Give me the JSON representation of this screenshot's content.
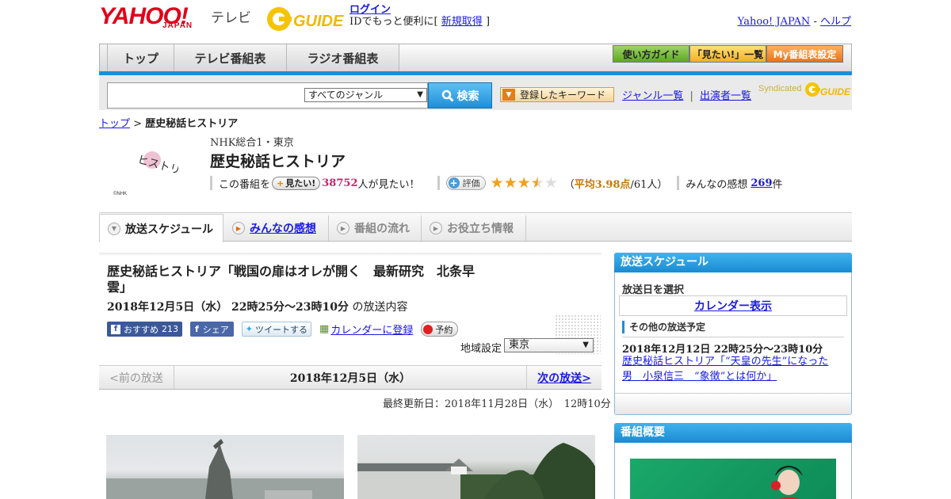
{
  "header": {
    "logo_yahoo": "YAHOO!",
    "logo_japan": "JAPAN",
    "logo_tv": "テレビ",
    "login": "ログイン",
    "login_note_pre": "IDでもっと便利に[",
    "register": "新規取得",
    "login_note_post": "]",
    "yahoo_japan": "Yahoo! JAPAN",
    "dash": "-",
    "help": "ヘルプ"
  },
  "nav": {
    "tabs": [
      "トップ",
      "テレビ番組表",
      "ラジオ番組表"
    ],
    "guide": "使い方ガイド",
    "mitai_list": "「見たい!」一覧",
    "my_settings": "My番組表設定"
  },
  "search": {
    "genre": "すべてのジャンル",
    "button": "検索",
    "keyword_btn": "登録したキーワード",
    "genre_list": "ジャンル一覧",
    "divider": "|",
    "performers": "出演者一覧",
    "syndicated": "Syndicated"
  },
  "breadcrumb": {
    "top": "トップ",
    "sep": ">",
    "current": "歴史秘話ヒストリア"
  },
  "program": {
    "channel": "NHK総合1・東京",
    "title": "歴史秘話ヒストリア",
    "logo_text": "ヒストリア",
    "logo_credit": "©NHK",
    "mitai_pre": "この番組を",
    "mitai_btn": "見たい!",
    "mitai_count": "38752",
    "mitai_post": "人が見たい！",
    "eval_btn": "評価",
    "rating_stars": 3.5,
    "rating_pre": "（",
    "rating_avg": "平均3.98点",
    "rating_post": "/61人）",
    "impressions_pre": "みんなの感想",
    "impressions_count": "269",
    "impressions_post": "件"
  },
  "subtabs": [
    "放送スケジュール",
    "みんなの感想",
    "番組の流れ",
    "お役立ち情報"
  ],
  "episode": {
    "title": "歴史秘話ヒストリア「戦国の扉はオレが開く　最新研究　北条早雲」",
    "date": "2018年12月5日（水） 22時25分～23時10分",
    "date_suffix": "の放送内容",
    "fb_recommend": "おすすめ",
    "fb_count": "213",
    "fb_share": "シェア",
    "tweet": "ツイートする",
    "calendar": "カレンダーに登録",
    "reserve": "予約",
    "region_label": "地域設定",
    "region": "東京",
    "prev": "<前の放送",
    "current_date": "2018年12月5日（水）",
    "next": "次の放送>",
    "updated": "最終更新日：2018年11月28日（水）　12時10分"
  },
  "sidebar": {
    "schedule_title": "放送スケジュール",
    "select_date": "放送日を選択",
    "calendar_view": "カレンダー表示",
    "other": "その他の放送予定",
    "next_date": "2018年12月12日  22時25分～23時10分",
    "next_link": "歴史秘話ヒストリア「“天皇の先生”になった男　小泉信三　“象徴”とは何か」",
    "summary_title": "番組概要"
  },
  "colors": {
    "accent": "#1a8fd6",
    "link": "#1a1ae0",
    "yahoo_red": "#e0001a",
    "pink": "#d0206c"
  }
}
